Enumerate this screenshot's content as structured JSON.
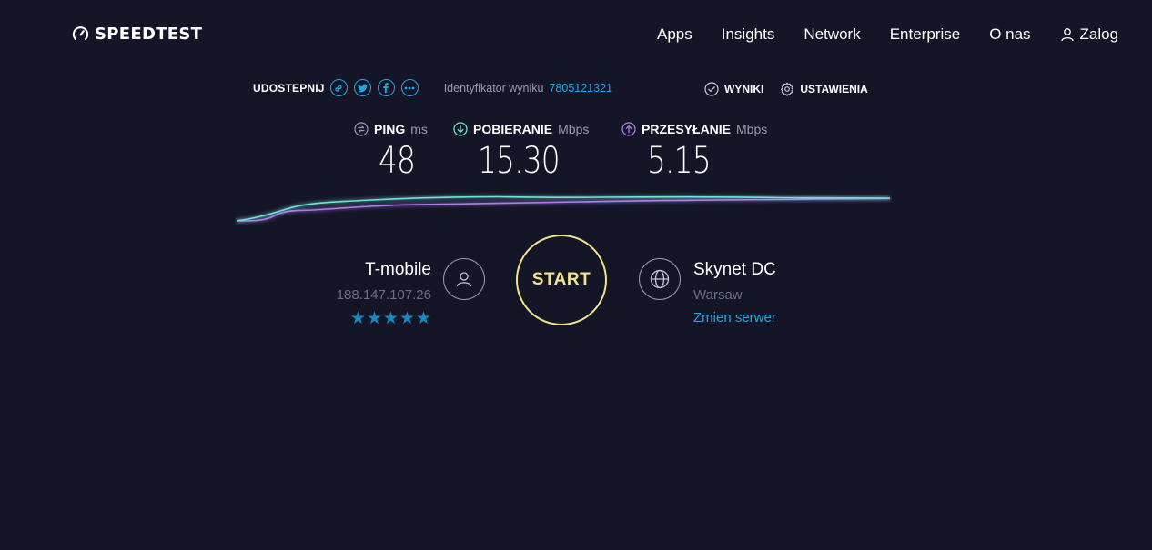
{
  "header": {
    "logo_text": "SPEEDTEST",
    "nav": [
      {
        "label": "Apps"
      },
      {
        "label": "Insights"
      },
      {
        "label": "Network"
      },
      {
        "label": "Enterprise"
      },
      {
        "label": "O nas"
      }
    ],
    "login_label": "Zalog"
  },
  "share": {
    "label": "UDOSTEPNIJ",
    "icons": [
      "link-icon",
      "twitter-icon",
      "facebook-icon",
      "more-icon"
    ],
    "result_label": "Identyfikator wyniku",
    "result_id": "7805121321"
  },
  "actions": {
    "results_label": "WYNIKI",
    "settings_label": "USTAWIENIA"
  },
  "metrics": {
    "ping": {
      "name": "PING",
      "unit": "ms",
      "value": "48",
      "icon": "ping-icon"
    },
    "download": {
      "name": "POBIERANIE",
      "unit": "Mbps",
      "value": "15.30",
      "icon": "download-icon"
    },
    "upload": {
      "name": "PRZESYŁANIE",
      "unit": "Mbps",
      "value": "5.15",
      "icon": "upload-icon"
    }
  },
  "colors": {
    "background": "#141526",
    "accent_blue": "#1ea8e6",
    "download_line": "#6fe3d6",
    "upload_line": "#b07cf0",
    "start": "#f2e48d",
    "stars": "#1a87bf"
  },
  "isp": {
    "name": "T-mobile",
    "ip": "188.147.107.26",
    "stars": "★★★★★",
    "rating": 5
  },
  "start_label": "START",
  "server": {
    "name": "Skynet DC",
    "city": "Warsaw",
    "change_label": "Zmien serwer"
  }
}
